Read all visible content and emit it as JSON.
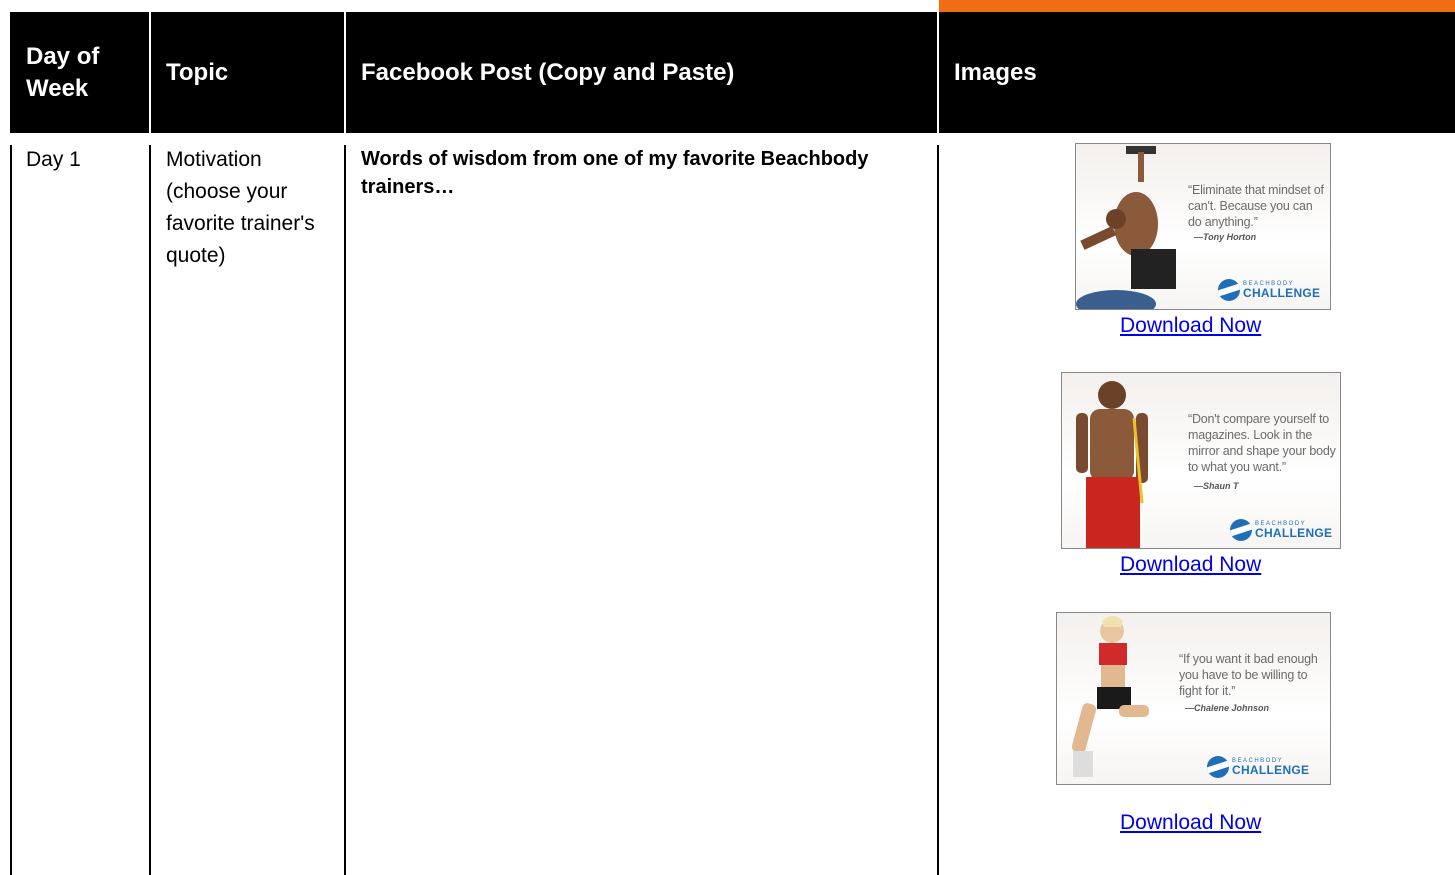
{
  "header": {
    "col_day": "Day of Week",
    "col_topic": "Topic",
    "col_post": "Facebook Post (Copy and Paste)",
    "col_images": "Images"
  },
  "row": {
    "day": "Day 1",
    "topic": "Motivation (choose your favorite trainer's quote)",
    "post": "Words of wisdom from one of my favorite Beachbody trainers…"
  },
  "images": [
    {
      "quote": "“Eliminate that mindset of can't. Because you can do anything.”",
      "author": "—Tony Horton",
      "logo_top": "BEACHBODY",
      "logo_bottom": "CHALLENGE",
      "link": "Download Now"
    },
    {
      "quote": "“Don't compare yourself to magazines. Look in the mirror and shape your body to what you want.”",
      "author": "—Shaun T",
      "logo_top": "BEACHBODY",
      "logo_bottom": "CHALLENGE",
      "link": "Download Now"
    },
    {
      "quote": "“If you want it bad enough you have to be willing to fight for it.”",
      "author": "—Chalene Johnson",
      "logo_top": "BEACHBODY",
      "logo_bottom": "CHALLENGE",
      "link": "Download Now"
    }
  ],
  "colors": {
    "accent_orange": "#f26b15",
    "header_bg": "#000000",
    "link_blue": "#0000ee",
    "logo_blue": "#1e6fb8"
  }
}
